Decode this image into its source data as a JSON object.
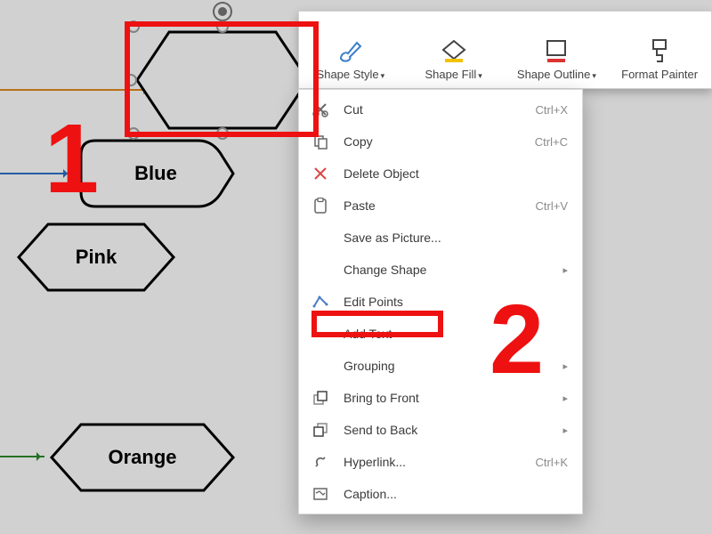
{
  "toolbar": {
    "shape_style": "Shape Style",
    "shape_fill": "Shape Fill",
    "shape_outline": "Shape Outline",
    "format_painter": "Format Painter"
  },
  "shapes": {
    "blue_label": "Blue",
    "pink_label": "Pink",
    "orange_label": "Orange"
  },
  "menu": {
    "cut": "Cut",
    "cut_shortcut": "Ctrl+X",
    "copy": "Copy",
    "copy_shortcut": "Ctrl+C",
    "delete_object": "Delete Object",
    "paste": "Paste",
    "paste_shortcut": "Ctrl+V",
    "save_as_picture": "Save as Picture...",
    "change_shape": "Change Shape",
    "edit_points": "Edit Points",
    "add_text": "Add Text",
    "grouping": "Grouping",
    "bring_to_front": "Bring to Front",
    "send_to_back": "Send to Back",
    "hyperlink": "Hyperlink...",
    "hyperlink_shortcut": "Ctrl+K",
    "caption": "Caption..."
  },
  "annotations": {
    "one": "1",
    "two": "2"
  }
}
